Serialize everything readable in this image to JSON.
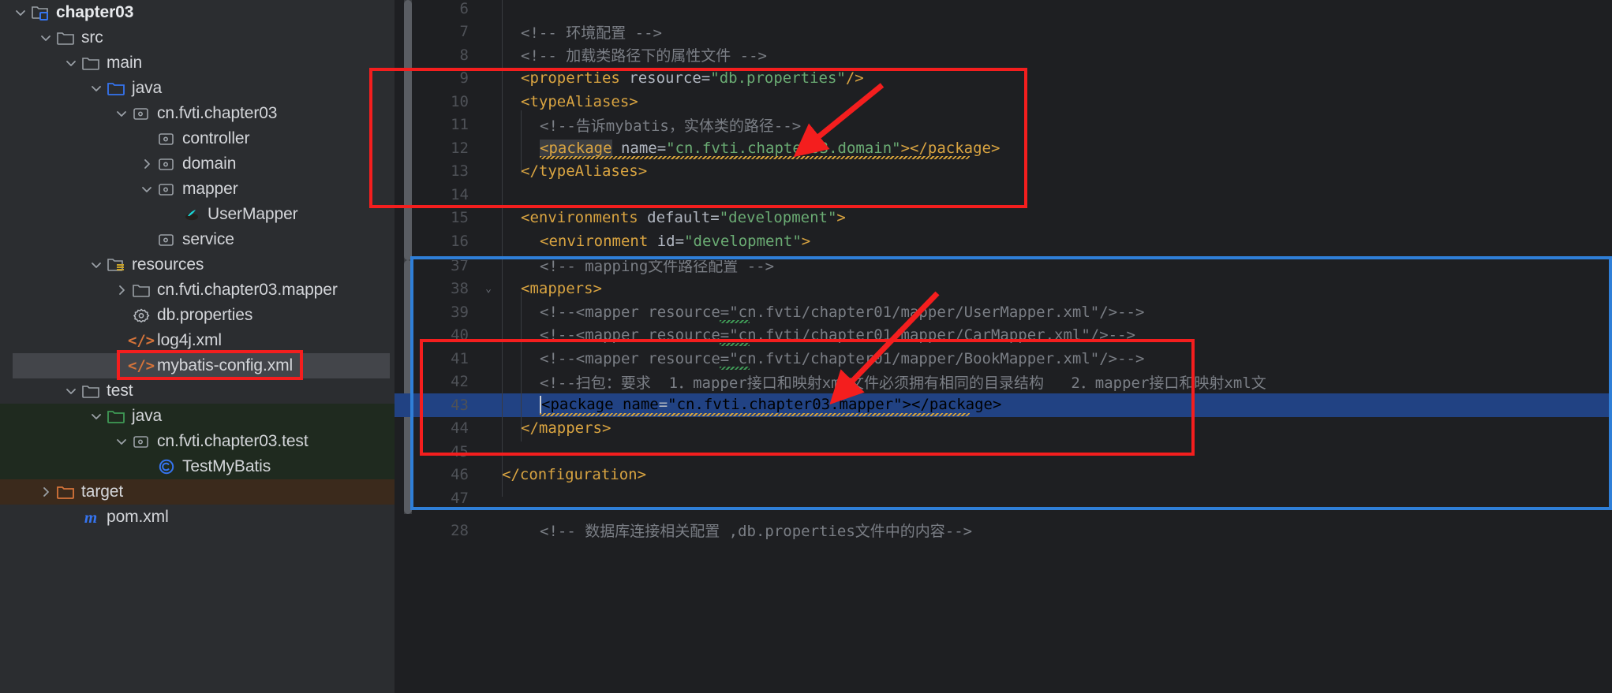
{
  "project_tree": {
    "items": [
      {
        "label": "chapter03",
        "indent": 1,
        "arrow": "down",
        "icon": "module-folder-icon",
        "bold": true,
        "state": "normal"
      },
      {
        "label": "src",
        "indent": 2,
        "arrow": "down",
        "icon": "folder-icon",
        "bold": false,
        "state": "normal"
      },
      {
        "label": "main",
        "indent": 3,
        "arrow": "down",
        "icon": "folder-icon",
        "bold": false,
        "state": "normal"
      },
      {
        "label": "java",
        "indent": 4,
        "arrow": "down",
        "icon": "source-folder-icon",
        "bold": false,
        "state": "normal"
      },
      {
        "label": "cn.fvti.chapter03",
        "indent": 5,
        "arrow": "down",
        "icon": "package-icon",
        "bold": false,
        "state": "normal"
      },
      {
        "label": "controller",
        "indent": 6,
        "arrow": "none",
        "icon": "package-icon",
        "bold": false,
        "state": "normal"
      },
      {
        "label": "domain",
        "indent": 6,
        "arrow": "right",
        "icon": "package-icon",
        "bold": false,
        "state": "normal"
      },
      {
        "label": "mapper",
        "indent": 6,
        "arrow": "down",
        "icon": "package-icon",
        "bold": false,
        "state": "normal"
      },
      {
        "label": "UserMapper",
        "indent": 7,
        "arrow": "none",
        "icon": "java-interface-icon",
        "bold": false,
        "state": "normal"
      },
      {
        "label": "service",
        "indent": 6,
        "arrow": "none",
        "icon": "package-icon",
        "bold": false,
        "state": "normal"
      },
      {
        "label": "resources",
        "indent": 4,
        "arrow": "down",
        "icon": "resources-folder-icon",
        "bold": false,
        "state": "normal"
      },
      {
        "label": "cn.fvti.chapter03.mapper",
        "indent": 5,
        "arrow": "right",
        "icon": "folder-icon",
        "bold": false,
        "state": "normal"
      },
      {
        "label": "db.properties",
        "indent": 5,
        "arrow": "none",
        "icon": "properties-file-icon",
        "bold": false,
        "state": "normal"
      },
      {
        "label": "log4j.xml",
        "indent": 5,
        "arrow": "none",
        "icon": "xml-file-icon",
        "bold": false,
        "state": "normal"
      },
      {
        "label": "mybatis-config.xml",
        "indent": 5,
        "arrow": "none",
        "icon": "xml-file-icon",
        "bold": false,
        "state": "selected"
      },
      {
        "label": "test",
        "indent": 3,
        "arrow": "down",
        "icon": "folder-icon",
        "bold": false,
        "state": "normal"
      },
      {
        "label": "java",
        "indent": 4,
        "arrow": "down",
        "icon": "test-source-folder-icon",
        "bold": false,
        "state": "green"
      },
      {
        "label": "cn.fvti.chapter03.test",
        "indent": 5,
        "arrow": "down",
        "icon": "package-icon",
        "bold": false,
        "state": "green"
      },
      {
        "label": "TestMyBatis",
        "indent": 6,
        "arrow": "none",
        "icon": "java-class-icon",
        "bold": false,
        "state": "green"
      },
      {
        "label": "target",
        "indent": 2,
        "arrow": "right",
        "icon": "excluded-folder-icon",
        "bold": false,
        "state": "brown"
      },
      {
        "label": "pom.xml",
        "indent": 3,
        "arrow": "none",
        "icon": "maven-file-icon",
        "bold": false,
        "state": "normal"
      }
    ]
  },
  "editor": {
    "top_pane": {
      "lines": [
        {
          "num": "6",
          "indent": 0,
          "segments": []
        },
        {
          "num": "7",
          "indent": 1,
          "segments": [
            {
              "t": "<!-- ",
              "c": "cmt"
            },
            {
              "t": "环境配置",
              "c": "cmt-cjk"
            },
            {
              "t": " -->",
              "c": "cmt"
            }
          ]
        },
        {
          "num": "8",
          "indent": 1,
          "segments": [
            {
              "t": "<!-- ",
              "c": "cmt"
            },
            {
              "t": "加载类路径下的属性文件",
              "c": "cmt-cjk"
            },
            {
              "t": " -->",
              "c": "cmt"
            }
          ]
        },
        {
          "num": "9",
          "indent": 1,
          "segments": [
            {
              "t": "<properties",
              "c": "tag"
            },
            {
              "t": " resource",
              "c": "attr"
            },
            {
              "t": "=",
              "c": "eq"
            },
            {
              "t": "\"db.properties\"",
              "c": "str"
            },
            {
              "t": "/>",
              "c": "tag"
            }
          ]
        },
        {
          "num": "10",
          "indent": 1,
          "segments": [
            {
              "t": "<typeAliases>",
              "c": "tag"
            }
          ]
        },
        {
          "num": "11",
          "indent": 2,
          "segments": [
            {
              "t": "<!--",
              "c": "cmt"
            },
            {
              "t": "告诉mybatis，实体类的路径",
              "c": "cmt-cjk"
            },
            {
              "t": "-->",
              "c": "cmt"
            }
          ]
        },
        {
          "num": "12",
          "indent": 2,
          "segments": [
            {
              "t": "<package",
              "c": "tag hl"
            },
            {
              "t": " name",
              "c": "attr"
            },
            {
              "t": "=",
              "c": "eq"
            },
            {
              "t": "\"cn.fvti.chapter03.domain\"",
              "c": "str"
            },
            {
              "t": ">",
              "c": "tag"
            },
            {
              "t": "</package>",
              "c": "tag hl2"
            }
          ]
        },
        {
          "num": "13",
          "indent": 1,
          "segments": [
            {
              "t": "</typeAliases>",
              "c": "tag"
            }
          ]
        },
        {
          "num": "14",
          "indent": 0,
          "segments": []
        },
        {
          "num": "15",
          "indent": 1,
          "segments": [
            {
              "t": "<environments",
              "c": "tag"
            },
            {
              "t": " default",
              "c": "attr"
            },
            {
              "t": "=",
              "c": "eq"
            },
            {
              "t": "\"development\"",
              "c": "str"
            },
            {
              "t": ">",
              "c": "tag"
            }
          ]
        },
        {
          "num": "16",
          "indent": 2,
          "segments": [
            {
              "t": "<environment",
              "c": "tag"
            },
            {
              "t": " id",
              "c": "attr"
            },
            {
              "t": "=",
              "c": "eq"
            },
            {
              "t": "\"development\"",
              "c": "str"
            },
            {
              "t": ">",
              "c": "tag"
            }
          ]
        }
      ]
    },
    "bottom_pane": {
      "lines": [
        {
          "num": "37",
          "indent": 2,
          "clipped": true,
          "segments": [
            {
              "t": "<!-- ",
              "c": "cmt"
            },
            {
              "t": "mapping文件路径配置",
              "c": "cmt-cjk"
            },
            {
              "t": " -->",
              "c": "cmt"
            }
          ]
        },
        {
          "num": "38",
          "indent": 1,
          "fold": "chevron-down",
          "segments": [
            {
              "t": "<mappers>",
              "c": "tag"
            }
          ]
        },
        {
          "num": "39",
          "indent": 2,
          "segments": [
            {
              "t": "<!--<mapper resource=\"cn.fvti/chapter01/mapper/UserMapper.xml\"/>-->",
              "c": "cmt"
            }
          ]
        },
        {
          "num": "40",
          "indent": 2,
          "segments": [
            {
              "t": "<!--<mapper resource=\"cn.fvti/chapter01/mapper/CarMapper.xml\"/>-->",
              "c": "cmt"
            }
          ]
        },
        {
          "num": "41",
          "indent": 2,
          "segments": [
            {
              "t": "<!--<mapper resource=\"cn.fvti/chapter01/mapper/BookMapper.xml\"/>-->",
              "c": "cmt"
            }
          ]
        },
        {
          "num": "42",
          "indent": 2,
          "segments": [
            {
              "t": "<!--扫包：要求  1．mapper接口和映射xml文件必须拥有相同的目录结构   2．mapper接口和映射xml文",
              "c": "cmt"
            }
          ]
        },
        {
          "num": "43",
          "indent": 2,
          "selected": true,
          "caret": true,
          "segments": [
            {
              "t": "<package",
              "c": "tag"
            },
            {
              "t": " name",
              "c": "attr"
            },
            {
              "t": "=",
              "c": "eq"
            },
            {
              "t": "\"cn.fvti.chapter03.mapper\"",
              "c": "str"
            },
            {
              "t": ">",
              "c": "tag"
            },
            {
              "t": "</package>",
              "c": "tag"
            }
          ]
        },
        {
          "num": "44",
          "indent": 1,
          "segments": [
            {
              "t": "</mappers>",
              "c": "tag"
            }
          ]
        },
        {
          "num": "45",
          "indent": 0,
          "segments": []
        },
        {
          "num": "46",
          "indent": 0,
          "segments": [
            {
              "t": "</configuration>",
              "c": "tag"
            }
          ]
        },
        {
          "num": "47",
          "indent": 0,
          "segments": []
        }
      ]
    },
    "tail_pane": {
      "lines": [
        {
          "num": "28",
          "indent": 2,
          "segments": [
            {
              "t": "<!-- ",
              "c": "cmt"
            },
            {
              "t": "数据库连接相关配置 ,db.properties文件中的内容",
              "c": "cmt-cjk"
            },
            {
              "t": "-->",
              "c": "cmt"
            }
          ]
        }
      ]
    }
  },
  "annotations": {
    "red_box_top": "highlight-typealiases-package-block",
    "red_box_bottom": "highlight-mappers-package-block",
    "red_box_tree": "highlight-mybatis-config-file",
    "blue_box": "highlight-mappers-section",
    "arrow_top": "arrow-pointing-to-domain-package",
    "arrow_bottom": "arrow-pointing-to-mapper-package",
    "accent_red": "#f41e1e",
    "accent_blue": "#2f7fd8",
    "selection_blue": "#214283"
  }
}
